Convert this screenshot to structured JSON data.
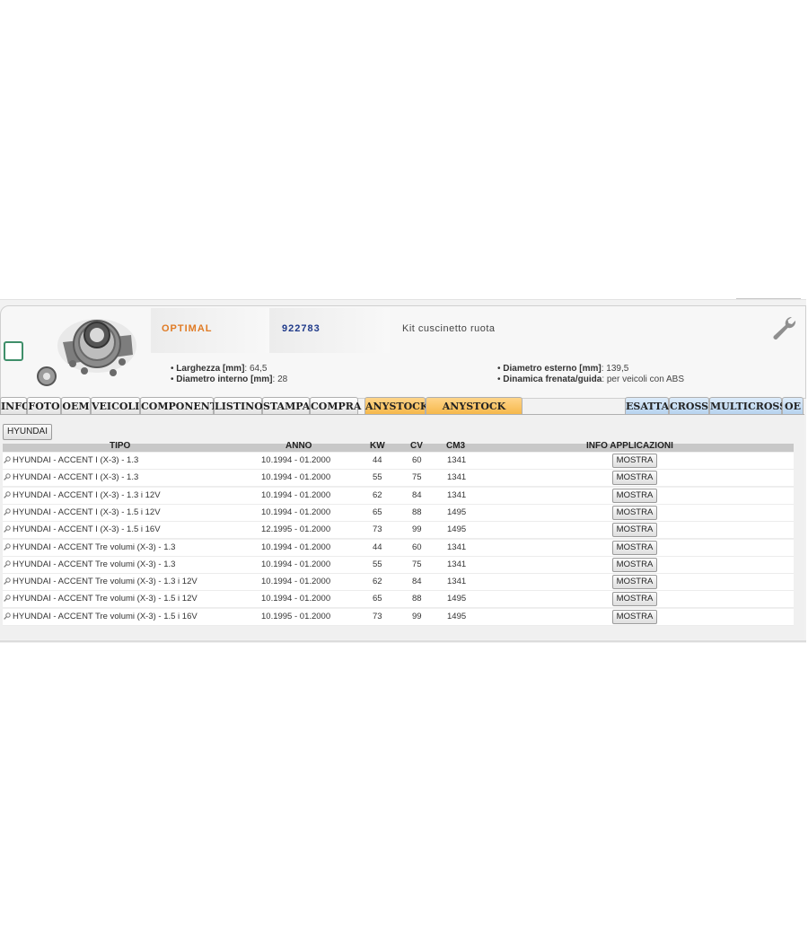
{
  "product": {
    "brand": "OPTIMAL",
    "code": "922783",
    "description": "Kit cuscinetto ruota",
    "specs_left": [
      {
        "label": "Larghezza [mm]",
        "value": ": 64,5"
      },
      {
        "label": "Diametro interno [mm]",
        "value": ": 28"
      }
    ],
    "specs_right": [
      {
        "label": "Diametro esterno [mm]",
        "value": ": 139,5"
      },
      {
        "label": "Dinamica frenata/guida",
        "value": ": per veicoli con ABS"
      }
    ]
  },
  "tabs": {
    "left": [
      "INFO",
      "FOTO",
      "OEM",
      "VEICOLI",
      "COMPONENTI",
      "LISTINO",
      "STAMPA",
      "COMPRA"
    ],
    "stock": [
      "ANYSTOCK",
      "ANYSTOCK CROSS"
    ],
    "right": [
      "ESATTA",
      "CROSS",
      "MULTICROSS",
      "OE"
    ]
  },
  "filter_button": "HYUNDAI",
  "table": {
    "headers": {
      "tipo": "TIPO",
      "anno": "ANNO",
      "kw": "KW",
      "cv": "CV",
      "cm3": "CM3",
      "info": "INFO APPLICAZIONI"
    },
    "button_label": "MOSTRA",
    "rows": [
      {
        "tipo": "HYUNDAI - ACCENT I (X-3) - 1.3",
        "anno": "10.1994 - 01.2000",
        "kw": "44",
        "cv": "60",
        "cm3": "1341"
      },
      {
        "tipo": "HYUNDAI - ACCENT I (X-3) - 1.3",
        "anno": "10.1994 - 01.2000",
        "kw": "55",
        "cv": "75",
        "cm3": "1341"
      },
      {
        "tipo": "HYUNDAI - ACCENT I (X-3) - 1.3 i 12V",
        "anno": "10.1994 - 01.2000",
        "kw": "62",
        "cv": "84",
        "cm3": "1341"
      },
      {
        "tipo": "HYUNDAI - ACCENT I (X-3) - 1.5 i 12V",
        "anno": "10.1994 - 01.2000",
        "kw": "65",
        "cv": "88",
        "cm3": "1495"
      },
      {
        "tipo": "HYUNDAI - ACCENT I (X-3) - 1.5 i 16V",
        "anno": "12.1995 - 01.2000",
        "kw": "73",
        "cv": "99",
        "cm3": "1495"
      },
      {
        "tipo": "HYUNDAI - ACCENT Tre volumi (X-3) - 1.3",
        "anno": "10.1994 - 01.2000",
        "kw": "44",
        "cv": "60",
        "cm3": "1341"
      },
      {
        "tipo": "HYUNDAI - ACCENT Tre volumi (X-3) - 1.3",
        "anno": "10.1994 - 01.2000",
        "kw": "55",
        "cv": "75",
        "cm3": "1341"
      },
      {
        "tipo": "HYUNDAI - ACCENT Tre volumi (X-3) - 1.3 i 12V",
        "anno": "10.1994 - 01.2000",
        "kw": "62",
        "cv": "84",
        "cm3": "1341"
      },
      {
        "tipo": "HYUNDAI - ACCENT Tre volumi (X-3) - 1.5 i 12V",
        "anno": "10.1994 - 01.2000",
        "kw": "65",
        "cv": "88",
        "cm3": "1495"
      },
      {
        "tipo": "HYUNDAI - ACCENT Tre volumi (X-3) - 1.5 i 16V",
        "anno": "10.1995 - 01.2000",
        "kw": "73",
        "cv": "99",
        "cm3": "1495"
      }
    ]
  },
  "colors": {
    "brand": "#e07b25",
    "code": "#1f3a8a",
    "tab_orange": "#f6b84b",
    "tab_blue": "#b7d3ef",
    "checkbox": "#3f8f6a"
  },
  "icons": [
    "wheel-hub-photo",
    "wrench-icon",
    "magnifier-icon",
    "select-checkbox"
  ]
}
